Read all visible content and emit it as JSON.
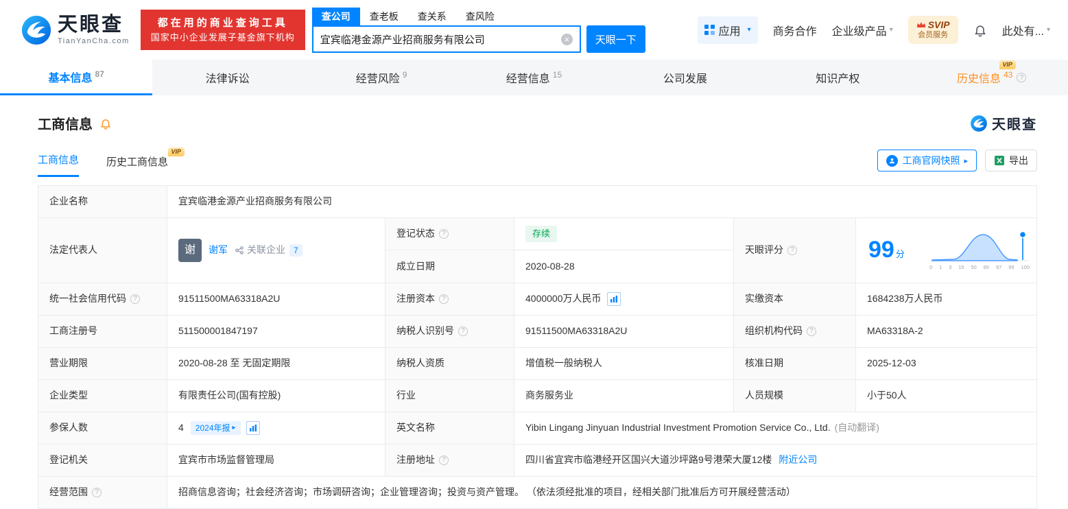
{
  "vip_label": "VIP",
  "header": {
    "logo": {
      "brand": "天眼查",
      "domain": "TianYanCha.com"
    },
    "promo": {
      "line1": "都在用的商业查询工具",
      "line2": "国家中小企业发展子基金旗下机构"
    },
    "search": {
      "tabs": [
        {
          "label": "查公司"
        },
        {
          "label": "查老板"
        },
        {
          "label": "查关系"
        },
        {
          "label": "查风险"
        }
      ],
      "value": "宜宾临港金源产业招商服务有限公司",
      "button": "天眼一下"
    },
    "menu": {
      "apps": "应用",
      "cooperation": "商务合作",
      "enterprise": "企业级产品",
      "svip_title": "SVIP",
      "svip_sub": "会员服务",
      "more": "此处有..."
    }
  },
  "nav": {
    "tabs": [
      {
        "label": "基本信息",
        "count": "87"
      },
      {
        "label": "法律诉讼",
        "count": ""
      },
      {
        "label": "经营风险",
        "count": "9"
      },
      {
        "label": "经营信息",
        "count": "15"
      },
      {
        "label": "公司发展",
        "count": ""
      },
      {
        "label": "知识产权",
        "count": ""
      },
      {
        "label": "历史信息",
        "count": "43"
      }
    ]
  },
  "section": {
    "title": "工商信息",
    "watermark": "天眼查",
    "tabs": [
      {
        "label": "工商信息"
      },
      {
        "label": "历史工商信息"
      }
    ],
    "actions": {
      "snapshot": "工商官网快照",
      "export": "导出"
    }
  },
  "table": {
    "company": {
      "label": "企业名称",
      "value": "宜宾临港金源产业招商服务有限公司"
    },
    "legal": {
      "label": "法定代表人",
      "avatar": "谢",
      "name": "谢军",
      "related": "关联企业",
      "related_count": "7"
    },
    "status": {
      "label": "登记状态",
      "value": "存续"
    },
    "established": {
      "label": "成立日期",
      "value": "2020-08-28"
    },
    "score": {
      "label": "天眼评分",
      "value": "99",
      "unit": "分",
      "ticks": [
        "0",
        "1",
        "3",
        "15",
        "50",
        "85",
        "97",
        "99",
        "100"
      ]
    },
    "rows": [
      {
        "cells": [
          {
            "label": "统一社会信用代码",
            "value": "91511500MA63318A2U"
          },
          {
            "label": "注册资本",
            "value": "4000000万人民币"
          },
          {
            "label": "实缴资本",
            "value": "1684238万人民币"
          }
        ]
      },
      {
        "cells": [
          {
            "label": "工商注册号",
            "value": "511500001847197"
          },
          {
            "label": "纳税人识别号",
            "value": "91511500MA63318A2U"
          },
          {
            "label": "组织机构代码",
            "value": "MA63318A-2"
          }
        ]
      },
      {
        "cells": [
          {
            "label": "营业期限",
            "value": "2020-08-28 至 无固定期限"
          },
          {
            "label": "纳税人资质",
            "value": "增值税一般纳税人"
          },
          {
            "label": "核准日期",
            "value": "2025-12-03"
          }
        ]
      },
      {
        "cells": [
          {
            "label": "企业类型",
            "value": "有限责任公司(国有控股)"
          },
          {
            "label": "行业",
            "value": "商务服务业"
          },
          {
            "label": "人员规模",
            "value": "小于50人"
          }
        ]
      }
    ],
    "insured": {
      "label": "参保人数",
      "value": "4",
      "report": "2024年报"
    },
    "english": {
      "label": "英文名称",
      "value": "Yibin Lingang Jinyuan Industrial Investment Promotion Service Co., Ltd.",
      "note": "(自动翻译)"
    },
    "authority": {
      "label": "登记机关",
      "value": "宜宾市市场监督管理局"
    },
    "address": {
      "label": "注册地址",
      "value": "四川省宜宾市临港经开区国兴大道沙坪路9号港荣大厦12楼",
      "link": "附近公司"
    },
    "scope": {
      "label": "经营范围",
      "value": "招商信息咨询；社会经济咨询；市场调研咨询；企业管理咨询；投资与资产管理。 （依法须经批准的项目，经相关部门批准后方可开展经营活动）"
    }
  }
}
